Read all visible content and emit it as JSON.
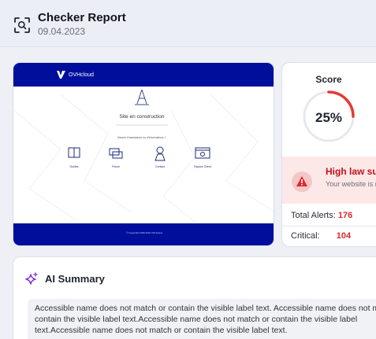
{
  "header": {
    "title": "Checker Report",
    "date": "09.04.2023",
    "icon": "scan-icon"
  },
  "preview": {
    "brand": "OVHcloud",
    "heading": "Site en construction",
    "subheading": "Besoin d'assistance ou d'informations ?",
    "links": [
      {
        "label": "Guides",
        "icon": "book-icon"
      },
      {
        "label": "Forum",
        "icon": "chat-icon"
      },
      {
        "label": "Contact",
        "icon": "contact-icon"
      },
      {
        "label": "Espace Client",
        "icon": "browser-icon"
      }
    ],
    "footer": "© Copyright 1999-2024 OVHcloud",
    "colors": {
      "brand": "#000e9c"
    }
  },
  "score": {
    "label": "Score",
    "value": "25%",
    "percent": 25,
    "colors": {
      "arc": "#e53935",
      "track": "#e6e8ee"
    }
  },
  "risk": {
    "title": "High law suit risk",
    "subtitle": "Your website is not compliant",
    "icon": "warning-icon"
  },
  "stats": [
    {
      "label": "Total Alerts:",
      "value": "176"
    },
    {
      "label": "Critical:",
      "value": "104"
    }
  ],
  "summary": {
    "title": "AI Summary",
    "icon": "sparkle-icon",
    "text": "Accessible name does not match or contain the visible label text. Accessible name does not match or contain the visible label text.Accessible name does not match or contain the visible label text.Accessible name does not match or contain the visible label text."
  }
}
